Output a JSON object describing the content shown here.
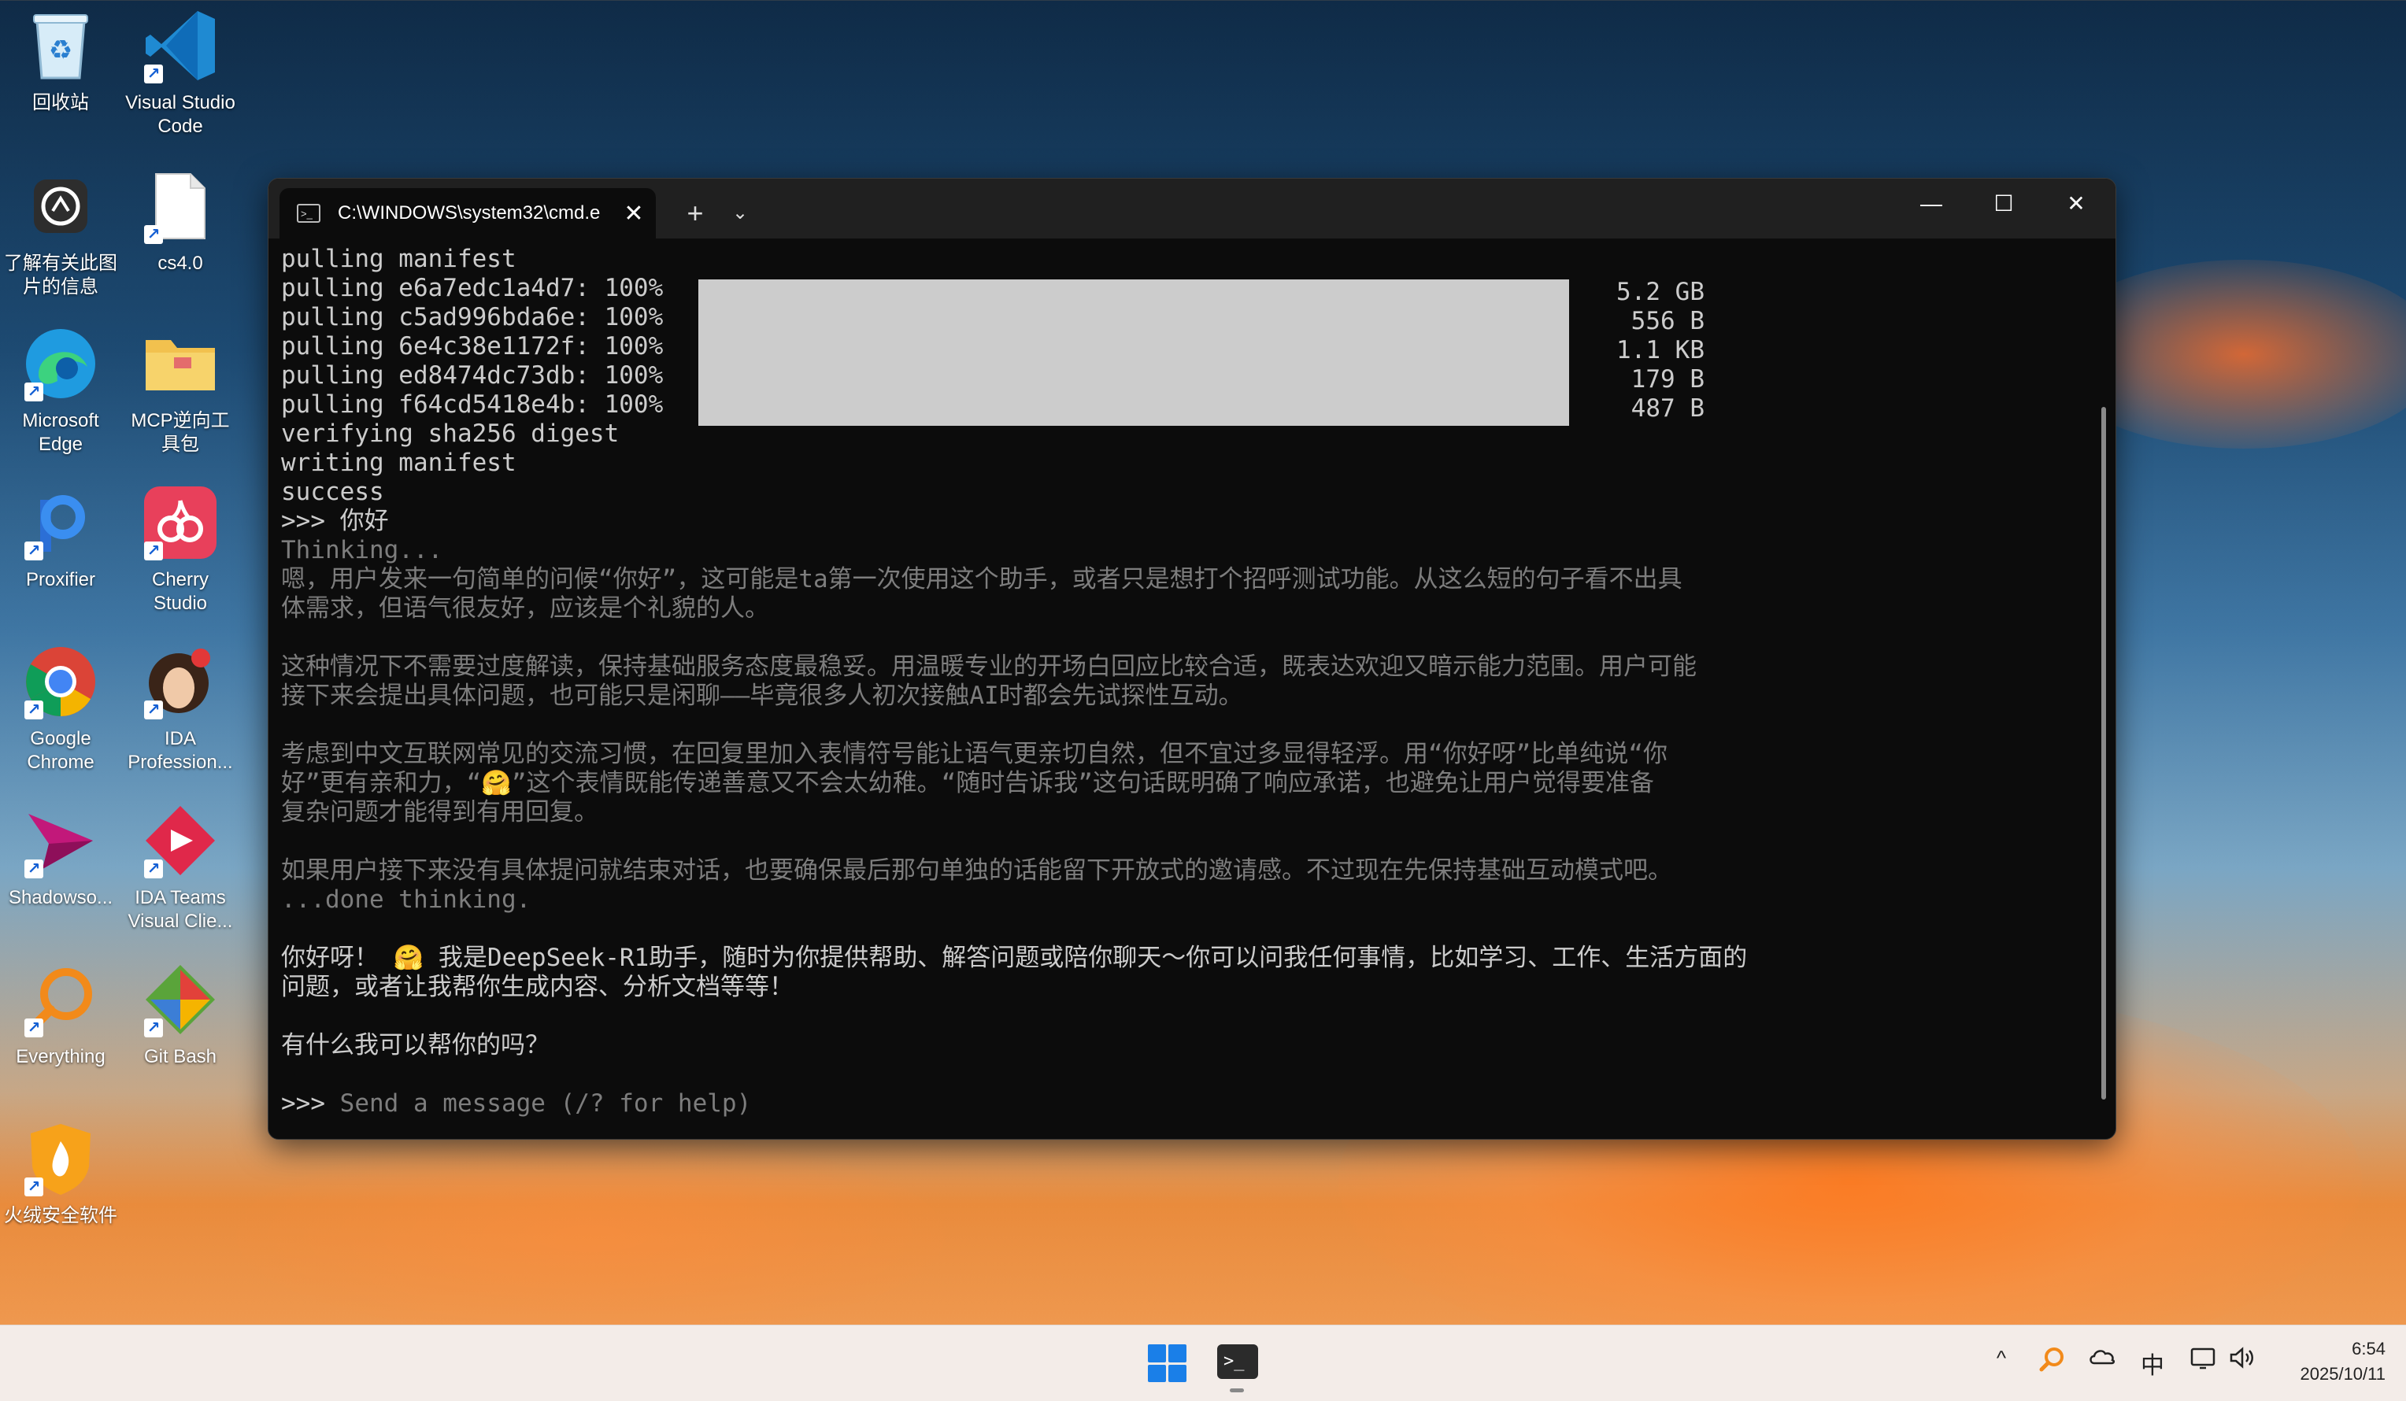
{
  "desktop": {
    "icons": [
      {
        "label": "回收站",
        "icon": "recycle-bin"
      },
      {
        "label": "Visual Studio\nCode",
        "icon": "vscode"
      },
      {
        "label": "了解有关此图\n片的信息",
        "icon": "info-camera"
      },
      {
        "label": "cs4.0",
        "icon": "file"
      },
      {
        "label": "Microsoft\nEdge",
        "icon": "edge"
      },
      {
        "label": "MCP逆向工\n具包",
        "icon": "folder"
      },
      {
        "label": "Proxifier",
        "icon": "proxifier"
      },
      {
        "label": "Cherry\nStudio",
        "icon": "cherry-studio"
      },
      {
        "label": "Google\nChrome",
        "icon": "chrome"
      },
      {
        "label": "IDA\nProfession...",
        "icon": "ida-pro"
      },
      {
        "label": "Shadowso...",
        "icon": "shadowsocks"
      },
      {
        "label": "IDA Teams\nVisual Clie...",
        "icon": "ida-teams"
      },
      {
        "label": "Everything",
        "icon": "everything"
      },
      {
        "label": "Git Bash",
        "icon": "git-bash"
      },
      {
        "label": "火绒安全软件",
        "icon": "huorong"
      }
    ]
  },
  "terminal": {
    "tab_title": "C:\\WINDOWS\\system32\\cmd.e",
    "new_tab": "+",
    "dropdown": "⌄",
    "controls": {
      "minimize": "—",
      "maximize": "☐",
      "close": "✕"
    },
    "lines": [
      "pulling manifest",
      "pulling e6a7edc1a4d7: 100%",
      "pulling c5ad996bda6e: 100%",
      "pulling 6e4c38e1172f: 100%",
      "pulling ed8474dc73db: 100%",
      "pulling f64cd5418e4b: 100%",
      "verifying sha256 digest",
      "writing manifest",
      "success",
      ">>> 你好",
      "Thinking..."
    ],
    "sizes": [
      "5.2 GB",
      "556 B",
      "1.1 KB",
      "179 B",
      "487 B"
    ],
    "progress": [
      1.0,
      1.0,
      1.0,
      1.0,
      1.0
    ],
    "paragraphs": [
      "嗯，用户发来一句简单的问候“你好”，这可能是ta第一次使用这个助手，或者只是想打个招呼测试功能。从这么短的句子看不出具\n体需求，但语气很友好，应该是个礼貌的人。",
      "这种情况下不需要过度解读，保持基础服务态度最稳妥。用温暖专业的开场白回应比较合适，既表达欢迎又暗示能力范围。用户可能\n接下来会提出具体问题，也可能只是闲聊——毕竟很多人初次接触AI时都会先试探性互动。",
      "考虑到中文互联网常见的交流习惯，在回复里加入表情符号能让语气更亲切自然，但不宜过多显得轻浮。用“你好呀”比单纯说“你\n好”更有亲和力，“🤗”这个表情既能传递善意又不会太幼稚。“随时告诉我”这句话既明确了响应承诺，也避免让用户觉得要准备\n复杂问题才能得到有用回复。",
      "如果用户接下来没有具体提问就结束对话，也要确保最后那句单独的话能留下开放式的邀请感。不过现在先保持基础互动模式吧。"
    ],
    "done_thinking": "...done thinking.",
    "answer": [
      "你好呀！ 🤗 我是DeepSeek-R1助手，随时为你提供帮助、解答问题或陪你聊天～你可以问我任何事情，比如学习、工作、生活方面的\n问题，或者让我帮你生成内容、分析文档等等！",
      "有什么我可以帮你的吗？"
    ],
    "prompt": ">>> ",
    "prompt_placeholder": "Send a message (/? for help)"
  },
  "taskbar": {
    "tray": {
      "chevron": "^",
      "ime": "中"
    },
    "time": "6:54",
    "date": "2025/10/11"
  }
}
